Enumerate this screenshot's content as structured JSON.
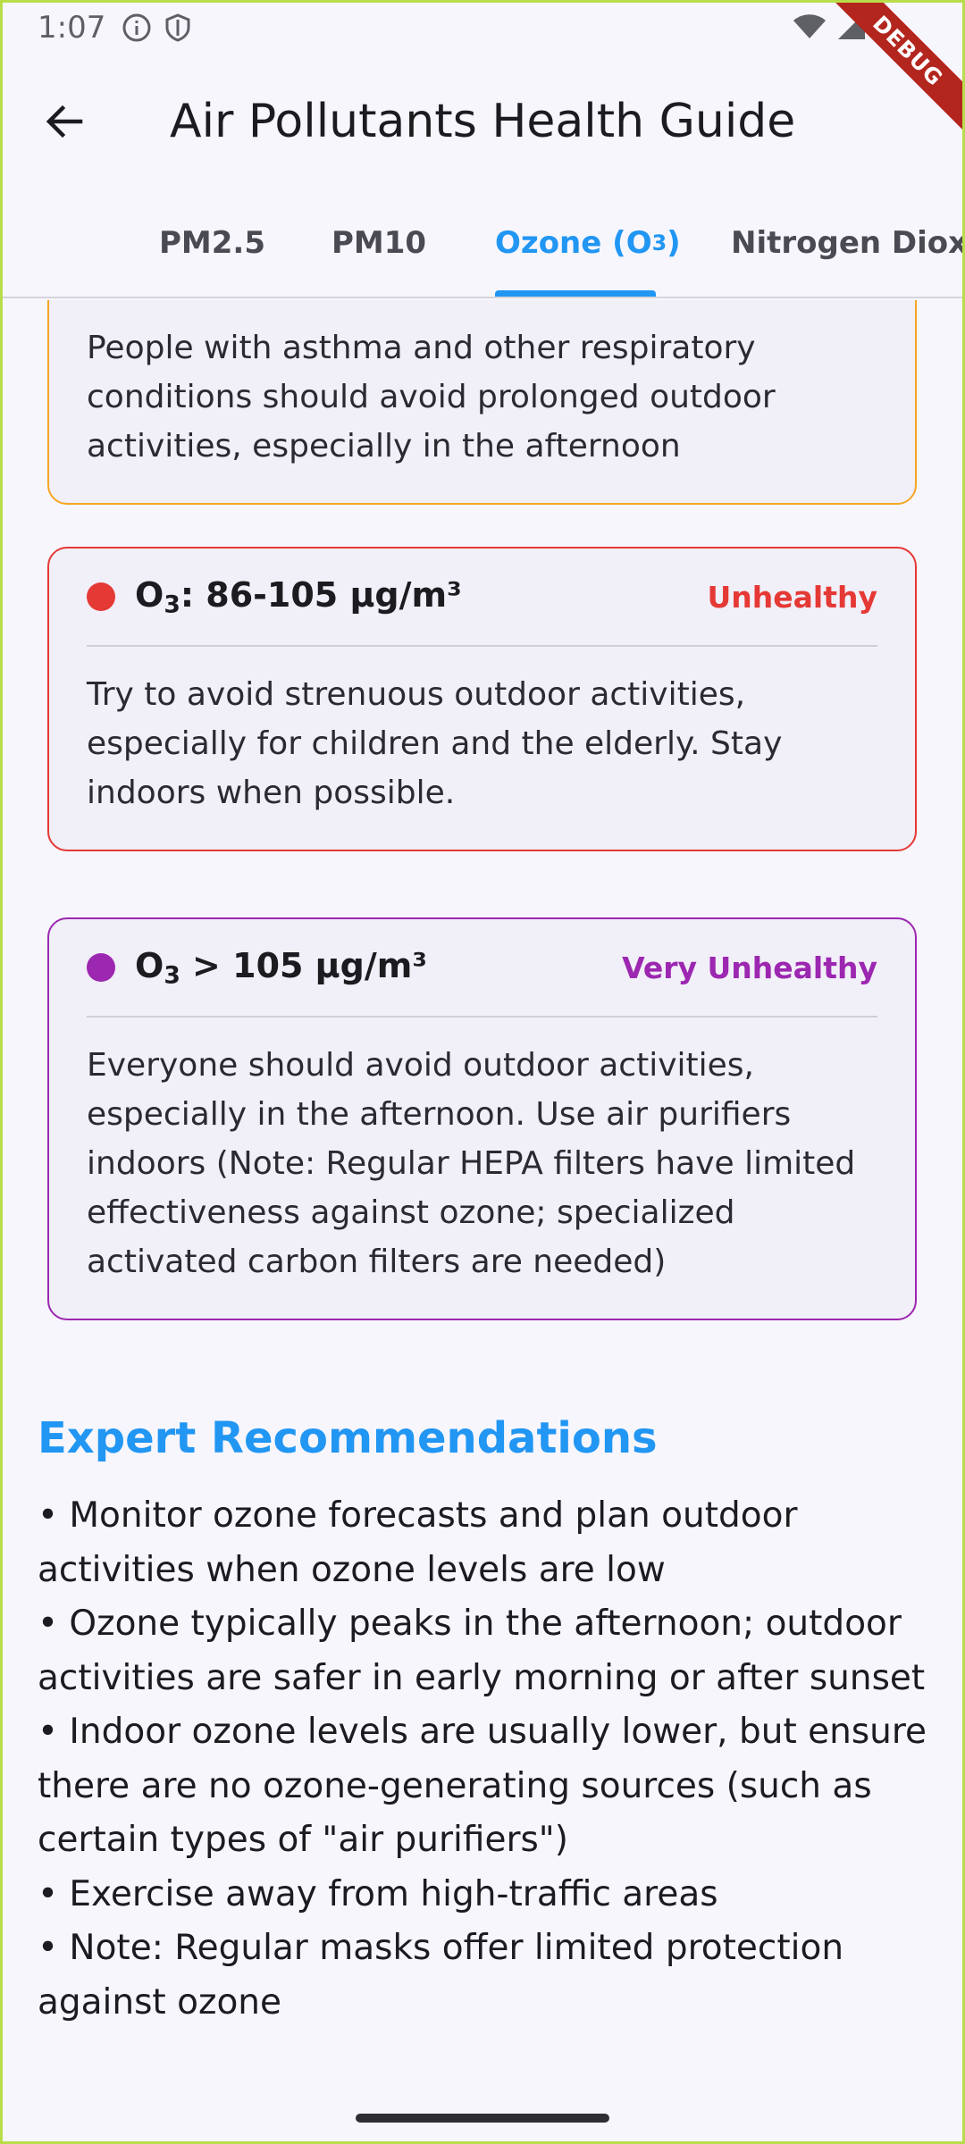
{
  "status_bar": {
    "time": "1:07",
    "icons_left": [
      "info-icon",
      "shield-icon"
    ],
    "icons_right": [
      "wifi-icon",
      "cell-signal-icon",
      "battery-icon"
    ]
  },
  "debug_banner": "DEBUG",
  "app_bar": {
    "back_icon": "arrow-back-icon",
    "title": "Air Pollutants Health Guide"
  },
  "tabs": [
    {
      "label": "PM2.5",
      "active": false
    },
    {
      "label": "PM10",
      "active": false
    },
    {
      "label_main": "Ozone (O",
      "label_sub": "3",
      "label_end": ")",
      "active": true
    },
    {
      "label": "Nitrogen Dioxide",
      "active": false
    }
  ],
  "cards": [
    {
      "text": "People with asthma and other respiratory conditions should avoid prolonged outdoor activities, especially in the afternoon",
      "color": "#f5a623"
    },
    {
      "range_pre": "O",
      "range_sub": "3",
      "range_post": ": 86-105 μg/m³",
      "level": "Unhealthy",
      "color": "#e53935",
      "text": "Try to avoid strenuous outdoor activities, especially for children and the elderly. Stay indoors when possible."
    },
    {
      "range_pre": "O",
      "range_sub": "3",
      "range_post": " > 105 μg/m³",
      "level": "Very Unhealthy",
      "color": "#9c27b0",
      "text": "Everyone should avoid outdoor activities, especially in the afternoon. Use air purifiers indoors (Note: Regular HEPA filters have limited effectiveness against ozone; specialized activated carbon filters are needed)"
    }
  ],
  "expert": {
    "title": "Expert Recommendations",
    "items": [
      "• Monitor ozone forecasts and plan outdoor activities when ozone levels are low",
      "• Ozone typically peaks in the afternoon; outdoor activities are safer in early morning or after sunset",
      "• Indoor ozone levels are usually lower, but ensure there are no ozone-generating sources (such as certain types of \"air purifiers\")",
      "• Exercise away from high-traffic areas",
      "• Note: Regular masks offer limited protection against ozone"
    ]
  }
}
